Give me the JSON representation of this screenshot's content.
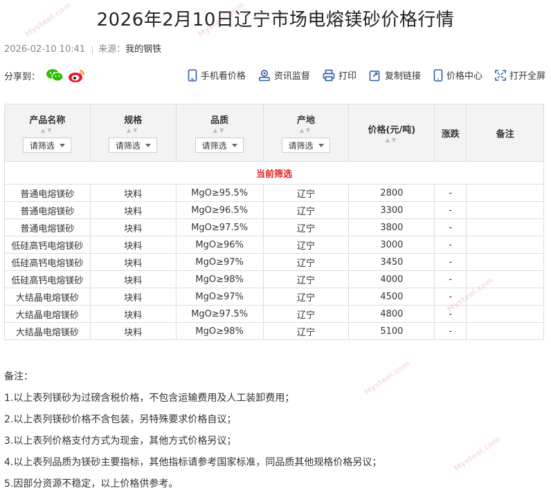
{
  "page": {
    "title": "2026年2月10日辽宁市场电熔镁砂价格行情",
    "date": "2026-02-10 10:41",
    "source_label": "来源：",
    "source_value": "我的钢铁"
  },
  "share": {
    "label": "分享到："
  },
  "toolbar": {
    "mobile": "手机看价格",
    "news": "资讯监督",
    "print": "打印",
    "copy": "复制链接",
    "center": "价格中心",
    "fullscreen": "打开全屏"
  },
  "table": {
    "headers": {
      "name": "产品名称",
      "spec": "规格",
      "quality": "品质",
      "origin": "产地",
      "price": "价格(元/吨)",
      "change": "涨跌",
      "remark": "备注"
    },
    "filter_label": "请筛选",
    "current_filter": "当前筛选",
    "rows": [
      {
        "name": "普通电熔镁砂",
        "spec": "块料",
        "quality": "MgO≥95.5%",
        "origin": "辽宁",
        "price": "2800",
        "change": "-",
        "remark": ""
      },
      {
        "name": "普通电熔镁砂",
        "spec": "块料",
        "quality": "MgO≥96.5%",
        "origin": "辽宁",
        "price": "3300",
        "change": "-",
        "remark": ""
      },
      {
        "name": "普通电熔镁砂",
        "spec": "块料",
        "quality": "MgO≥97.5%",
        "origin": "辽宁",
        "price": "3800",
        "change": "-",
        "remark": ""
      },
      {
        "name": "低硅高钙电熔镁砂",
        "spec": "块料",
        "quality": "MgO≥96%",
        "origin": "辽宁",
        "price": "3000",
        "change": "-",
        "remark": ""
      },
      {
        "name": "低硅高钙电熔镁砂",
        "spec": "块料",
        "quality": "MgO≥97%",
        "origin": "辽宁",
        "price": "3450",
        "change": "-",
        "remark": ""
      },
      {
        "name": "低硅高钙电熔镁砂",
        "spec": "块料",
        "quality": "MgO≥98%",
        "origin": "辽宁",
        "price": "4000",
        "change": "-",
        "remark": ""
      },
      {
        "name": "大结晶电熔镁砂",
        "spec": "块料",
        "quality": "MgO≥97%",
        "origin": "辽宁",
        "price": "4500",
        "change": "-",
        "remark": ""
      },
      {
        "name": "大结晶电熔镁砂",
        "spec": "块料",
        "quality": "MgO≥97.5%",
        "origin": "辽宁",
        "price": "4800",
        "change": "-",
        "remark": ""
      },
      {
        "name": "大结晶电熔镁砂",
        "spec": "块料",
        "quality": "MgO≥98%",
        "origin": "辽宁",
        "price": "5100",
        "change": "-",
        "remark": ""
      }
    ]
  },
  "notes": {
    "heading": "备注：",
    "lines": [
      "1.以上表列镁砂为过磅含税价格，不包含运输费用及人工装卸费用；",
      "2.以上表列镁砂价格不含包装，另特殊要求价格自议；",
      "3.以上表列价格支付方式为现金，其他方式价格另议；",
      "4.以上表列品质为镁砂主要指标，其他指标请参考国家标准，同品质其他规格价格另议；",
      "5.因部分资源不稳定，以上价格供参考。"
    ]
  },
  "watermark": {
    "text": "Mysteel.com"
  },
  "colors": {
    "accent_red": "#e02020",
    "wechat_green": "#2dc100",
    "weibo_red": "#e6162d",
    "icon_blue": "#2a5caa"
  }
}
